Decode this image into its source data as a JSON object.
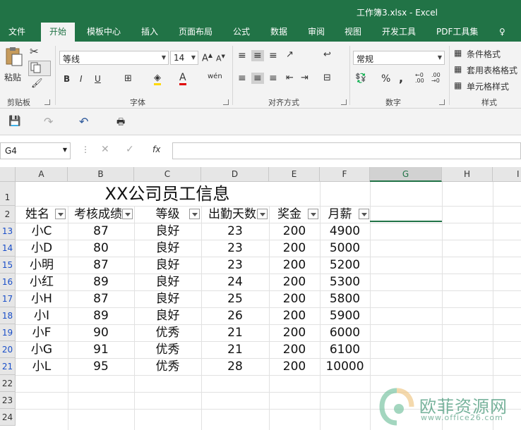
{
  "window": {
    "title": "工作簿3.xlsx - Excel"
  },
  "tabs": [
    {
      "label": "文件"
    },
    {
      "label": "开始"
    },
    {
      "label": "模板中心"
    },
    {
      "label": "插入"
    },
    {
      "label": "页面布局"
    },
    {
      "label": "公式"
    },
    {
      "label": "数据"
    },
    {
      "label": "审阅"
    },
    {
      "label": "视图"
    },
    {
      "label": "开发工具"
    },
    {
      "label": "PDF工具集"
    },
    {
      "label": "♀"
    }
  ],
  "ribbon": {
    "paste_label": "粘贴",
    "clipboard_label": "剪贴板",
    "font_name": "等线",
    "font_size": "14",
    "font_label": "字体",
    "align_label": "对齐方式",
    "number_format": "常规",
    "number_label": "数字",
    "conditional_format": "条件格式",
    "table_format": "套用表格格式",
    "cell_style": "单元格样式",
    "style_label": "样式",
    "bold": "B",
    "italic": "I",
    "underline": "U",
    "wen": "wén",
    "percent": "%",
    "comma": ","
  },
  "formula_bar": {
    "name_box": "G4",
    "fx": "fx",
    "formula": ""
  },
  "sheet": {
    "columns": [
      "A",
      "B",
      "C",
      "D",
      "E",
      "F",
      "G",
      "H",
      "I"
    ],
    "selected_column": "G",
    "title": "XX公司员工信息",
    "headers": [
      "姓名",
      "考核成绩",
      "等级",
      "出勤天数",
      "奖金",
      "月薪"
    ],
    "rows": [
      {
        "num": "13",
        "cells": [
          "小C",
          "87",
          "良好",
          "23",
          "200",
          "4900"
        ]
      },
      {
        "num": "14",
        "cells": [
          "小D",
          "80",
          "良好",
          "23",
          "200",
          "5000"
        ]
      },
      {
        "num": "15",
        "cells": [
          "小明",
          "87",
          "良好",
          "23",
          "200",
          "5200"
        ]
      },
      {
        "num": "16",
        "cells": [
          "小红",
          "89",
          "良好",
          "24",
          "200",
          "5300"
        ]
      },
      {
        "num": "17",
        "cells": [
          "小H",
          "87",
          "良好",
          "25",
          "200",
          "5800"
        ]
      },
      {
        "num": "18",
        "cells": [
          "小I",
          "89",
          "良好",
          "26",
          "200",
          "5900"
        ]
      },
      {
        "num": "19",
        "cells": [
          "小F",
          "90",
          "优秀",
          "21",
          "200",
          "6000"
        ]
      },
      {
        "num": "20",
        "cells": [
          "小G",
          "91",
          "优秀",
          "21",
          "200",
          "6100"
        ]
      },
      {
        "num": "21",
        "cells": [
          "小L",
          "95",
          "优秀",
          "28",
          "200",
          "10000"
        ]
      }
    ],
    "empty_rows": [
      "22",
      "23",
      "24"
    ],
    "title_row": "1",
    "header_row": "2"
  },
  "watermark": {
    "text": "欧菲资源网",
    "url": "www.office26.com"
  },
  "colors": {
    "excel_green": "#217346",
    "filtered_row": "#1a4fc9"
  }
}
